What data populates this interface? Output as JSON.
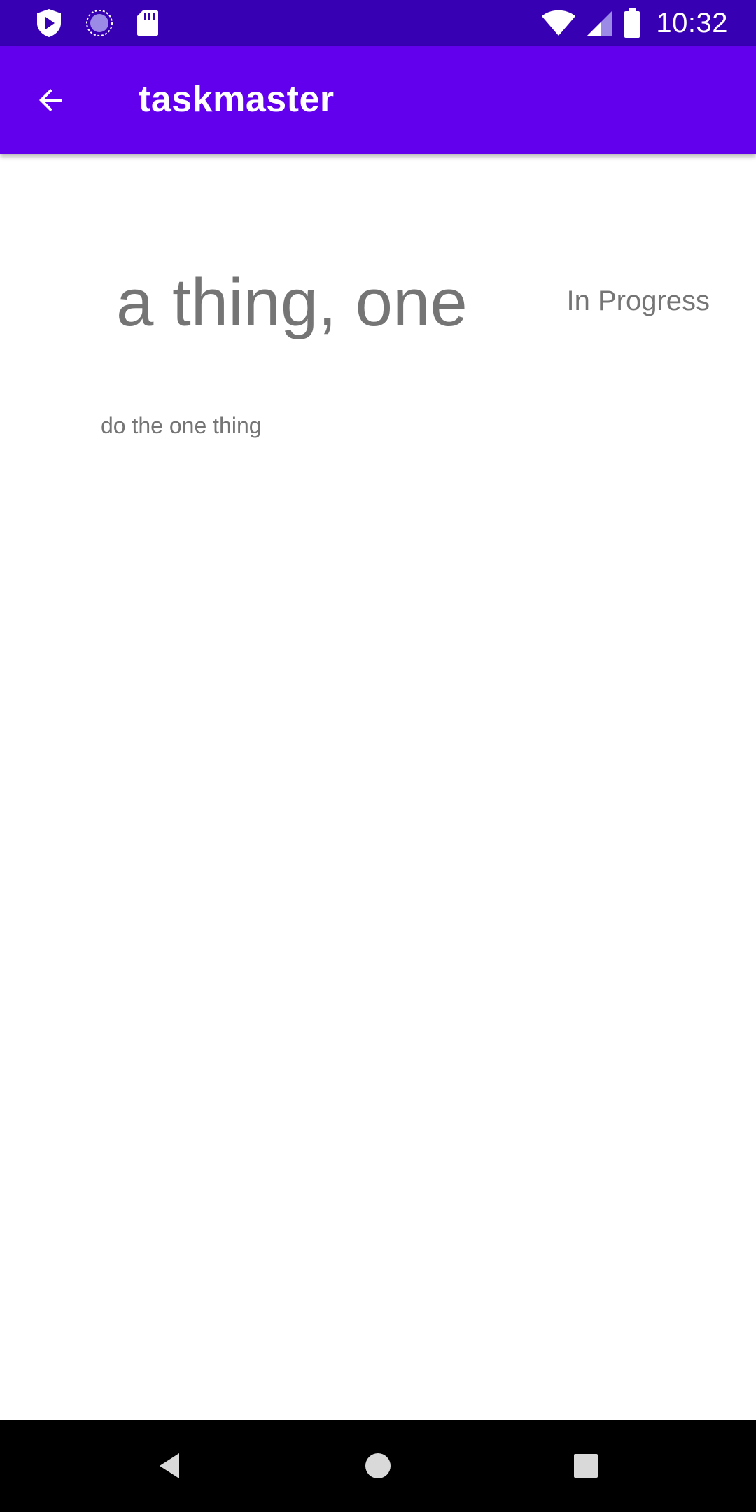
{
  "status_bar": {
    "time": "10:32",
    "icons": {
      "left": [
        "shield-play-icon",
        "loading-circle-icon",
        "sd-card-icon"
      ],
      "right": [
        "wifi-icon",
        "cell-signal-icon",
        "battery-icon"
      ]
    },
    "color": "#3700B3"
  },
  "app_bar": {
    "title": "taskmaster",
    "back_icon": "arrow-back-icon",
    "color": "#6200EE"
  },
  "task": {
    "title": "a thing, one",
    "status": "In Progress",
    "description": "do the one thing"
  },
  "nav_bar": {
    "icons": [
      "back-triangle-icon",
      "home-circle-icon",
      "recents-square-icon"
    ]
  },
  "colors": {
    "text_secondary": "#757575",
    "background": "#FFFFFF"
  }
}
